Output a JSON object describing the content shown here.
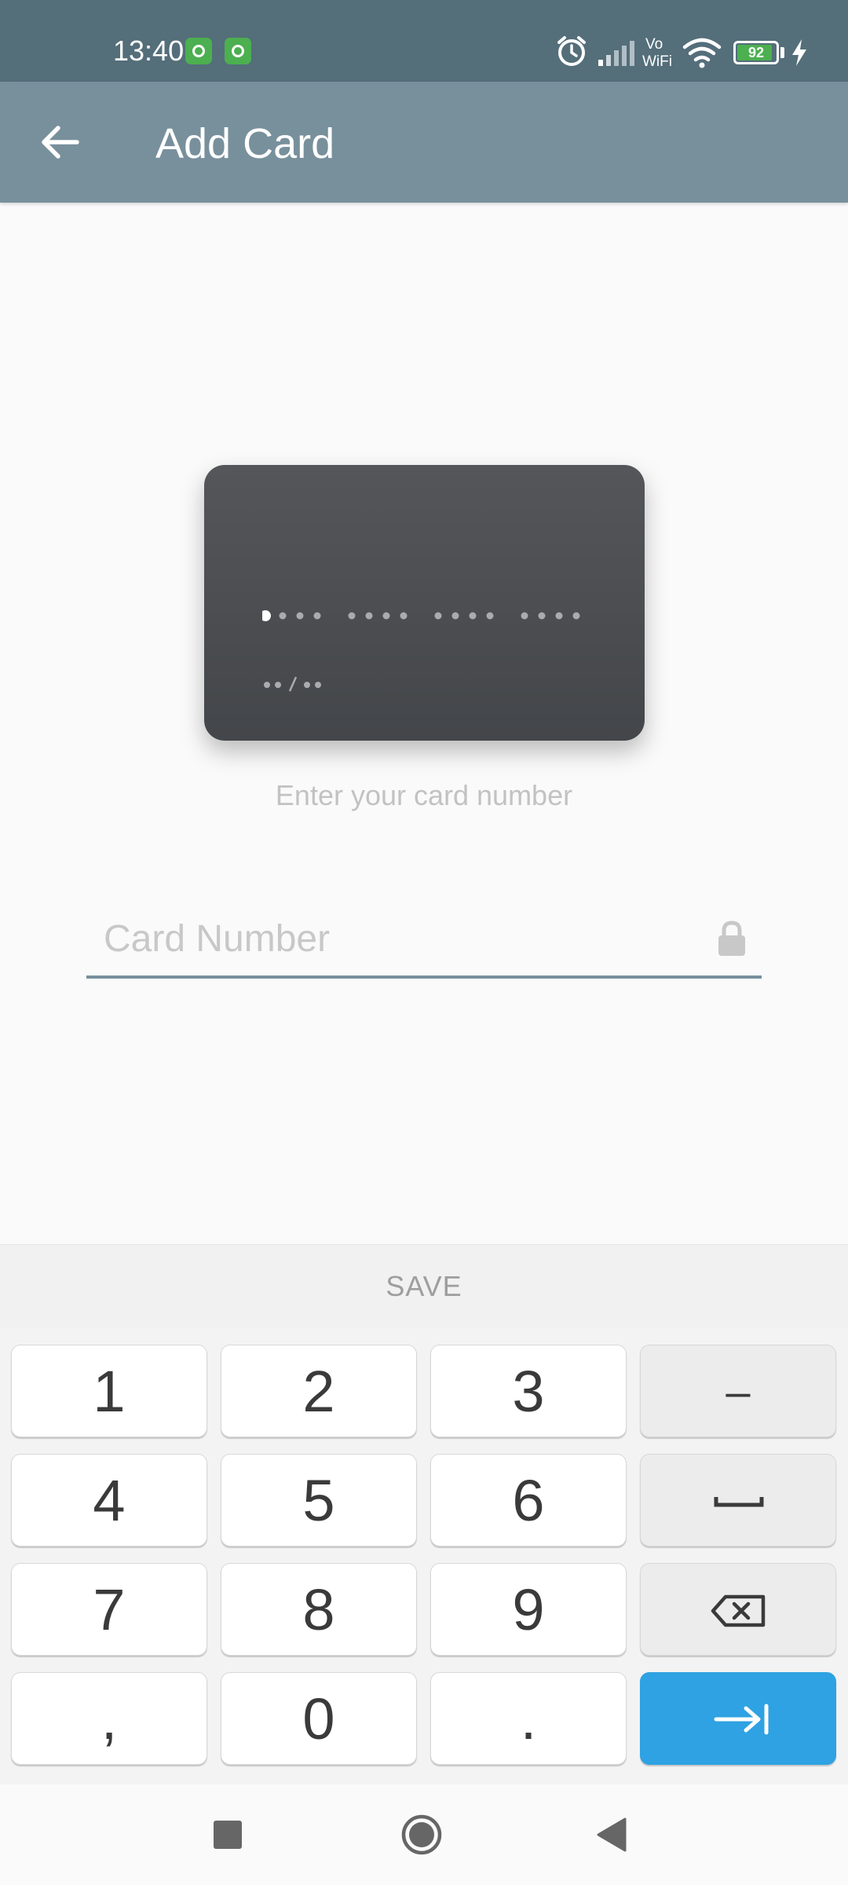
{
  "status_bar": {
    "time": "13:40",
    "battery_level": "92",
    "battery_fraction": 0.92,
    "icons": [
      "app-notification-icon",
      "app-notification-icon",
      "alarm-icon",
      "signal-icon",
      "vowifi-icon",
      "wifi-icon",
      "battery-icon",
      "charging-icon"
    ]
  },
  "app_bar": {
    "title": "Add Card",
    "back_icon": "arrow-left-icon"
  },
  "card_preview": {
    "number_groups": 4,
    "active_dot_index": 0,
    "expiry_mask": "••/••"
  },
  "hint": "Enter your card number",
  "card_input": {
    "value": "",
    "placeholder": "Card Number",
    "trailing_icon": "lock-icon"
  },
  "save_label": "SAVE",
  "keyboard": {
    "rows": [
      [
        "1",
        "2",
        "3",
        "–"
      ],
      [
        "4",
        "5",
        "6",
        "space"
      ],
      [
        "7",
        "8",
        "9",
        "backspace"
      ],
      [
        ",",
        "0",
        ".",
        "next"
      ]
    ],
    "keys": {
      "k1": "1",
      "k2": "2",
      "k3": "3",
      "dash": "–",
      "k4": "4",
      "k5": "5",
      "k6": "6",
      "k7": "7",
      "k8": "8",
      "k9": "9",
      "comma": ",",
      "k0": "0",
      "period": "."
    },
    "accent_color": "#2ea2e2"
  },
  "nav_bar": {
    "buttons": [
      "recents-icon",
      "home-icon",
      "back-icon"
    ]
  },
  "colors": {
    "status_bar": "#546e7a",
    "app_bar": "#78909c",
    "card": "#4a4c50",
    "input_underline": "#78909c"
  }
}
